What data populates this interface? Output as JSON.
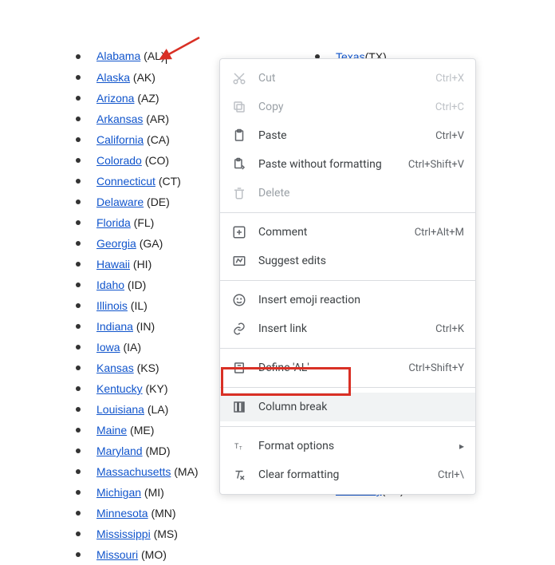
{
  "states_col1": [
    {
      "name": "Alabama",
      "abbr": "(AL)",
      "cursor": true
    },
    {
      "name": "Alaska",
      "abbr": "(AK)"
    },
    {
      "name": "Arizona",
      "abbr": "(AZ)"
    },
    {
      "name": "Arkansas",
      "abbr": "(AR)"
    },
    {
      "name": "California",
      "abbr": "(CA)"
    },
    {
      "name": "Colorado",
      "abbr": "(CO)"
    },
    {
      "name": "Connecticut",
      "abbr": "(CT)"
    },
    {
      "name": "Delaware",
      "abbr": "(DE)"
    },
    {
      "name": "Florida",
      "abbr": "(FL)"
    },
    {
      "name": "Georgia",
      "abbr": "(GA)"
    },
    {
      "name": "Hawaii",
      "abbr": "(HI)"
    },
    {
      "name": "Idaho",
      "abbr": "(ID)"
    },
    {
      "name": "Illinois",
      "abbr": "(IL)"
    },
    {
      "name": "Indiana",
      "abbr": "(IN)"
    },
    {
      "name": "Iowa",
      "abbr": "(IA)"
    },
    {
      "name": "Kansas",
      "abbr": "(KS)"
    },
    {
      "name": "Kentucky",
      "abbr": "(KY)"
    },
    {
      "name": "Louisiana",
      "abbr": "(LA)"
    },
    {
      "name": "Maine",
      "abbr": "(ME)"
    },
    {
      "name": "Maryland",
      "abbr": "(MD)"
    },
    {
      "name": "Massachusetts",
      "abbr": "(MA)"
    },
    {
      "name": "Michigan",
      "abbr": "(MI)"
    },
    {
      "name": "Minnesota",
      "abbr": "(MN)"
    },
    {
      "name": "Mississippi",
      "abbr": "(MS)"
    },
    {
      "name": "Missouri",
      "abbr": "(MO)"
    }
  ],
  "states_col2_top": [
    {
      "name": "Texas",
      "abbr": "(TX)"
    }
  ],
  "states_col2_bottom": [
    {
      "name": "Kentucky",
      "abbr": "(KY)"
    }
  ],
  "menu": {
    "cut": {
      "label": "Cut",
      "shortcut": "Ctrl+X"
    },
    "copy": {
      "label": "Copy",
      "shortcut": "Ctrl+C"
    },
    "paste": {
      "label": "Paste",
      "shortcut": "Ctrl+V"
    },
    "paste_plain": {
      "label": "Paste without formatting",
      "shortcut": "Ctrl+Shift+V"
    },
    "delete": {
      "label": "Delete"
    },
    "comment": {
      "label": "Comment",
      "shortcut": "Ctrl+Alt+M"
    },
    "suggest": {
      "label": "Suggest edits"
    },
    "emoji": {
      "label": "Insert emoji reaction"
    },
    "link": {
      "label": "Insert link",
      "shortcut": "Ctrl+K"
    },
    "define": {
      "label": "Define 'AL'",
      "shortcut": "Ctrl+Shift+Y"
    },
    "column_break": {
      "label": "Column break"
    },
    "format": {
      "label": "Format options"
    },
    "clear": {
      "label": "Clear formatting",
      "shortcut": "Ctrl+\\"
    }
  },
  "colors": {
    "link": "#1155cc",
    "highlight": "#d93025"
  }
}
